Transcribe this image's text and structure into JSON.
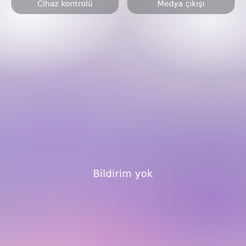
{
  "quick_settings": {
    "device_control_label": "Cihaz kontrolü",
    "media_output_label": "Medya çıkışı"
  },
  "notifications": {
    "empty_text": "Bildirim yok"
  }
}
